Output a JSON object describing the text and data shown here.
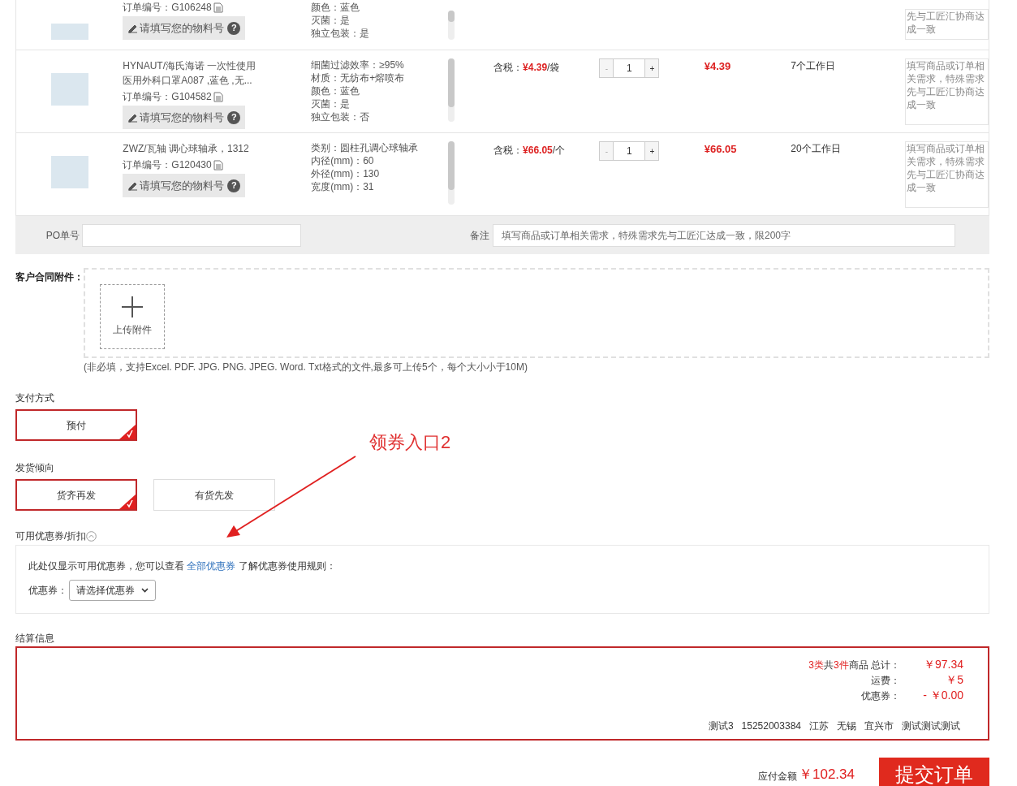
{
  "items": [
    {
      "order_label": "订单编号：",
      "order_no": "G106248",
      "material_placeholder": "请填写您的物料号",
      "specs": [
        "颜色：蓝色",
        "灭菌：是",
        "独立包装：是"
      ],
      "remark": "先与工匠汇协商达成一致",
      "help": "?",
      "partial": true
    },
    {
      "title": "HYNAUT/海氏海诺 一次性使用医用外科口罩A087 ,蓝色 ,无...",
      "order_label": "订单编号：",
      "order_no": "G104582",
      "material_placeholder": "请填写您的物料号",
      "specs": [
        "细菌过滤效率：≥95%",
        "材质：无纺布+熔喷布",
        "颜色：蓝色",
        "灭菌：是",
        "独立包装：否"
      ],
      "price_label": "含税：",
      "price": "¥4.39",
      "unit": "/袋",
      "minus": "-",
      "qty": "1",
      "plus": "+",
      "subtotal": "¥4.39",
      "lead_time": "7个工作日",
      "remark": "填写商品或订单相关需求，特殊需求先与工匠汇协商达成一致",
      "help": "?",
      "partial": false
    },
    {
      "title": "ZWZ/瓦轴 调心球轴承，1312",
      "order_label": "订单编号：",
      "order_no": "G120430",
      "material_placeholder": "请填写您的物料号",
      "specs": [
        "类别：圆柱孔调心球轴承",
        "内径(mm)：60",
        "外径(mm)：130",
        "宽度(mm)：31"
      ],
      "price_label": "含税：",
      "price": "¥66.05",
      "unit": "/个",
      "minus": "-",
      "qty": "1",
      "plus": "+",
      "subtotal": "¥66.05",
      "lead_time": "20个工作日",
      "remark": "填写商品或订单相关需求，特殊需求先与工匠汇协商达成一致",
      "help": "?",
      "partial": false
    }
  ],
  "po": {
    "label": "PO单号",
    "remark_label": "备注",
    "remark_placeholder": "填写商品或订单相关需求，特殊需求先与工匠汇达成一致，限200字"
  },
  "attachments": {
    "label": "客户合同附件：",
    "upload": "上传附件",
    "note": "(非必填，支持Excel. PDF. JPG. PNG. JPEG. Word. Txt格式的文件,最多可上传5个，每个大小小于10M)"
  },
  "payment": {
    "label": "支付方式",
    "options": [
      {
        "label": "预付",
        "selected": true
      }
    ]
  },
  "shipping": {
    "label": "发货倾向",
    "options": [
      {
        "label": "货齐再发",
        "selected": true
      },
      {
        "label": "有货先发",
        "selected": false
      }
    ]
  },
  "coupons": {
    "label": "可用优惠券/折扣",
    "expanded": true,
    "text_before": "此处仅显示可用优惠券，您可以查看",
    "link": "全部优惠券",
    "text_after": "了解优惠券使用规则：",
    "select_label": "优惠券：",
    "select_value": "请选择优惠券"
  },
  "annotation": {
    "text": "领券入口2"
  },
  "settlement": {
    "label": "结算信息",
    "lines": [
      {
        "label_parts": [
          {
            "text": "3类",
            "highlight": true
          },
          {
            "text": "共",
            "highlight": false
          },
          {
            "text": "3件",
            "highlight": true
          },
          {
            "text": "商品 总计：",
            "highlight": false
          }
        ],
        "value": "￥97.34"
      },
      {
        "label_parts": [
          {
            "text": "运费：",
            "highlight": false
          }
        ],
        "value": "￥5"
      },
      {
        "label_parts": [
          {
            "text": "优惠券：",
            "highlight": false
          }
        ],
        "value": "- ￥0.00"
      }
    ],
    "address": [
      "测试3",
      "15252003384",
      "江苏",
      "无锡",
      "宜兴市",
      "测试测试测试"
    ]
  },
  "footer": {
    "amount_label": "应付金额",
    "amount": "￥102.34",
    "submit": "提交订单"
  }
}
